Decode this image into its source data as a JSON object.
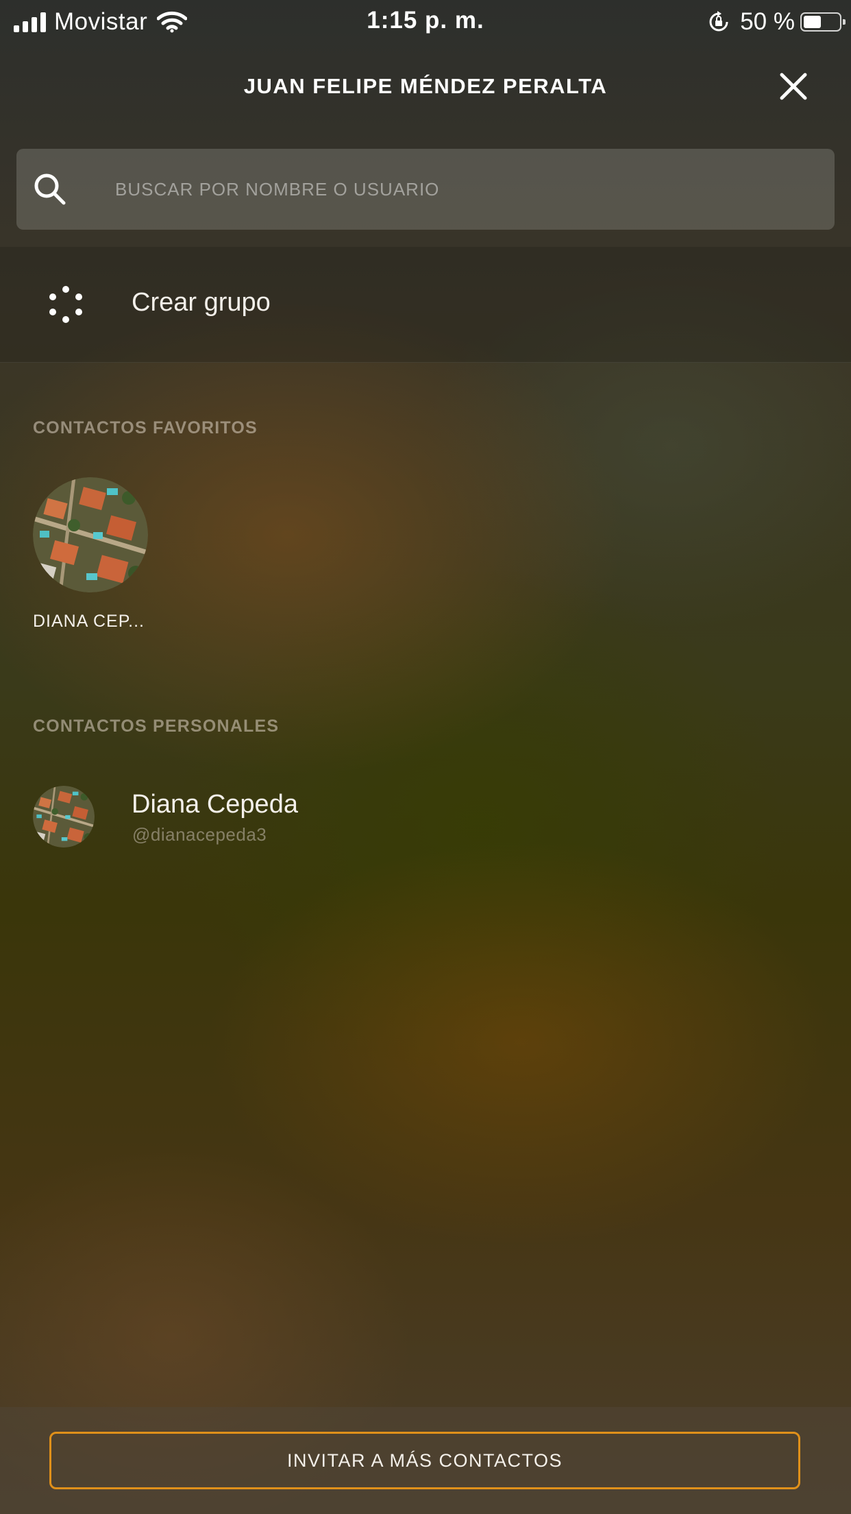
{
  "status_bar": {
    "carrier": "Movistar",
    "time": "1:15 p. m.",
    "battery_text": "50 %",
    "battery_level": 0.5,
    "icons": [
      "cellular-signal-icon",
      "wifi-icon",
      "orientation-lock-icon",
      "battery-icon"
    ]
  },
  "header": {
    "title": "JUAN FELIPE MÉNDEZ PERALTA",
    "close_icon": "close-icon"
  },
  "search": {
    "placeholder": "BUSCAR POR NOMBRE O USUARIO",
    "value": "",
    "icon": "search-icon"
  },
  "create_group": {
    "label": "Crear grupo",
    "icon": "group-dots-icon"
  },
  "favorites": {
    "section_title": "CONTACTOS FAVORITOS",
    "items": [
      {
        "name": "DIANA CEP..."
      }
    ]
  },
  "personal": {
    "section_title": "CONTACTOS PERSONALES",
    "items": [
      {
        "name": "Diana Cepeda",
        "username": "@dianacepeda3"
      }
    ]
  },
  "footer": {
    "invite_label": "INVITAR A MÁS CONTACTOS"
  },
  "colors": {
    "accent": "#e0901a"
  }
}
